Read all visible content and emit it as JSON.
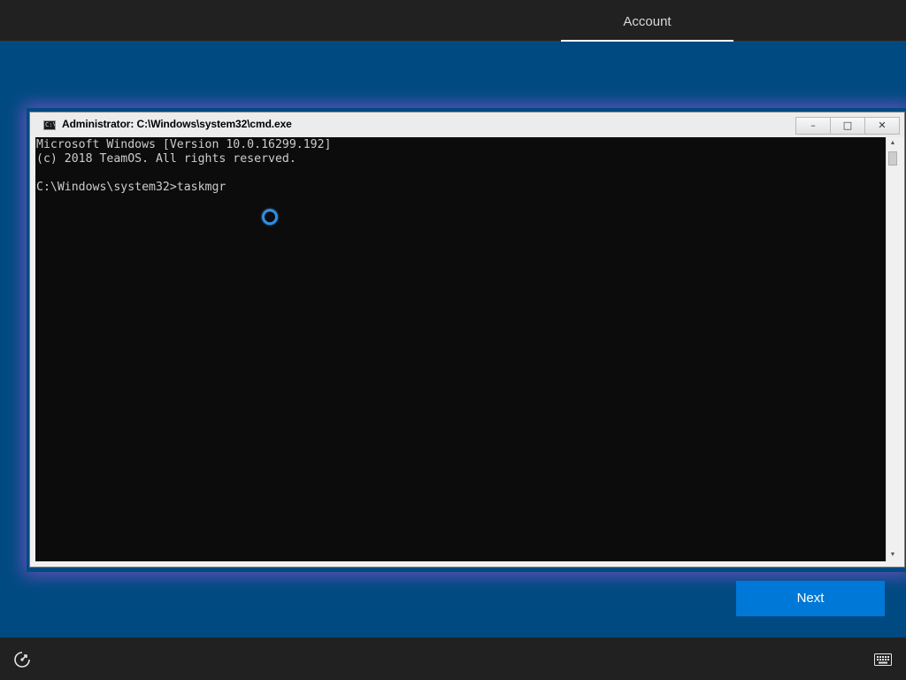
{
  "top_bar": {
    "active_tab": "Account"
  },
  "cmd_window": {
    "title": "Administrator: C:\\Windows\\system32\\cmd.exe",
    "icon": "cmd-icon",
    "icon_text": "C:\\",
    "buttons": {
      "minimize": "–",
      "maximize": "□",
      "close": "✕"
    },
    "lines": [
      "Microsoft Windows [Version 10.0.16299.192]",
      "(c) 2018 TeamOS. All rights reserved.",
      "",
      "C:\\Windows\\system32>taskmgr"
    ]
  },
  "next_button": {
    "label": "Next"
  },
  "bottom_bar": {
    "left_icon": "ease-of-access-icon",
    "right_icon": "keyboard-icon"
  },
  "colors": {
    "background": "#004a82",
    "bar": "#212121",
    "accent": "#0078d7",
    "console": "#0c0c0c",
    "busy_cursor": "#2f8fe8"
  }
}
